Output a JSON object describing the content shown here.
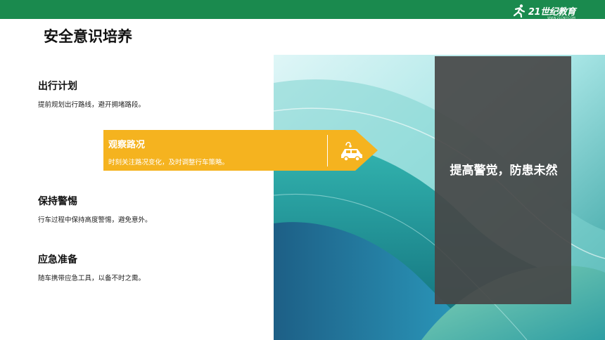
{
  "header": {
    "brand_text": "21世纪教育",
    "brand_sub": "WWW.21CNJY.COM",
    "accent_color": "#1a8a4e"
  },
  "slide": {
    "title": "安全意识培养",
    "items": [
      {
        "title": "出行计划",
        "desc": "提前规划出行路线，避开拥堵路段。"
      },
      {
        "title": "观察路况",
        "desc": "时刻关注路况变化，及时调整行车策略。"
      },
      {
        "title": "保持警惕",
        "desc": "行车过程中保持高度警惕，避免意外。"
      },
      {
        "title": "应急准备",
        "desc": "随车携带应急工具，以备不时之需。"
      }
    ],
    "highlight_color": "#f5b31f",
    "panel_text": "提高警觉，防患未然",
    "icons": {
      "callout": "car-icon",
      "logo": "runner-icon"
    }
  }
}
